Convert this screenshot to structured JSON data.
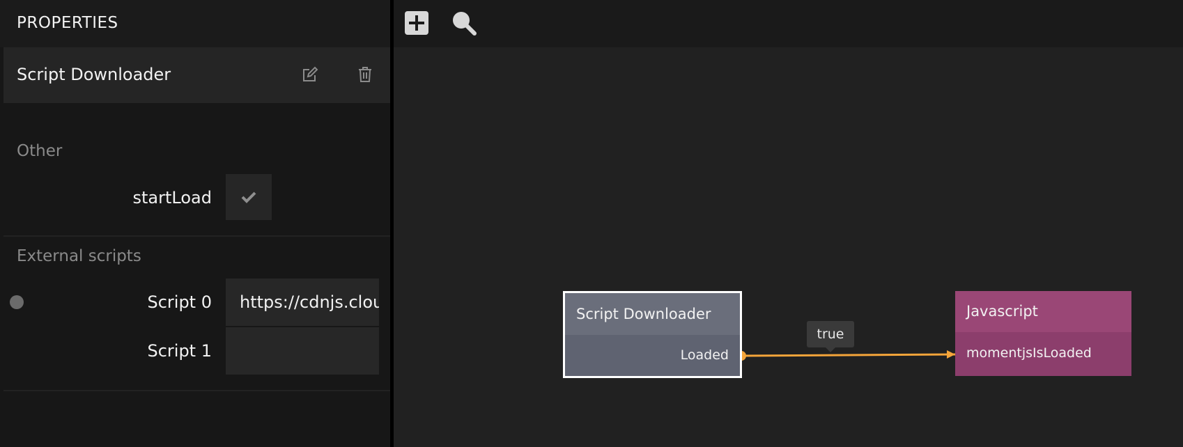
{
  "panel": {
    "title": "PROPERTIES",
    "node_name": "Script Downloader",
    "edit_icon": "edit-icon",
    "delete_icon": "trash-icon",
    "sections": {
      "other": {
        "label": "Other",
        "startLoad_label": "startLoad",
        "startLoad_checked": true
      },
      "external": {
        "label": "External scripts",
        "script0_label": "Script 0",
        "script0_value": "https://cdnjs.cloud",
        "script1_label": "Script 1",
        "script1_value": ""
      }
    }
  },
  "toolbar": {
    "add_icon": "plus-icon",
    "search_icon": "search-icon"
  },
  "graph": {
    "node_sd": {
      "title": "Script Downloader",
      "output_port": "Loaded"
    },
    "node_js": {
      "title": "Javascript",
      "input_port": "momentjsIsLoaded"
    },
    "edge_label": "true",
    "colors": {
      "edge": "#f5a53a",
      "sd_node": "#5f6371",
      "js_node": "#8c3e6c"
    }
  }
}
